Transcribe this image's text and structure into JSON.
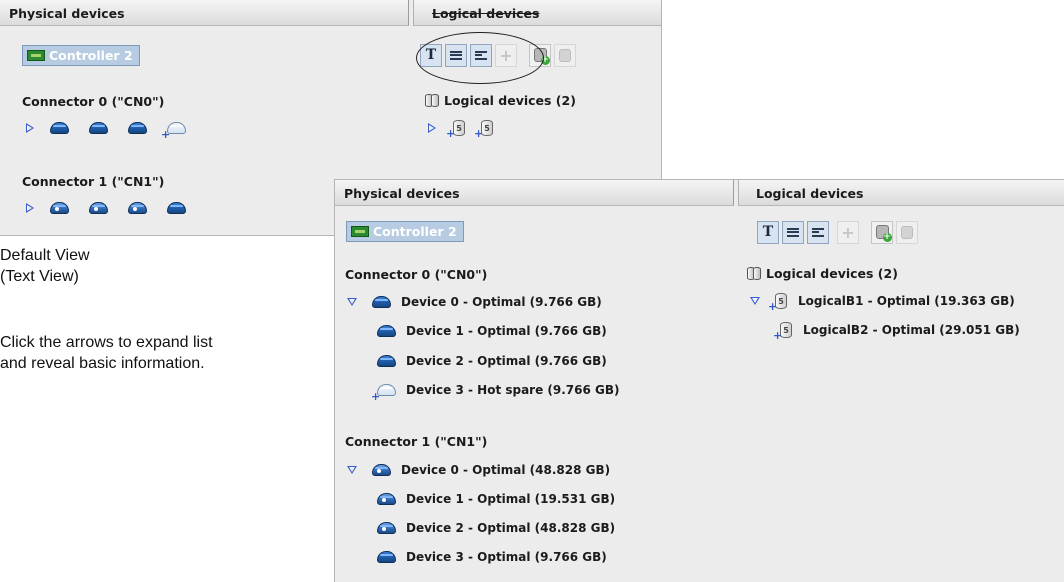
{
  "back_panel": {
    "physical_header": "Physical devices",
    "logical_header": "Logical devices",
    "controller_label": "Controller 2",
    "connector0_label": "Connector 0 (\"CN0\")",
    "connector1_label": "Connector 1 (\"CN1\")",
    "logical_group_label": "Logical devices (2)",
    "logical_device_badge": "5"
  },
  "front_panel": {
    "physical_header": "Physical devices",
    "logical_header": "Logical devices",
    "controller_label": "Controller 2",
    "connector0": {
      "label": "Connector 0 (\"CN0\")",
      "devices": [
        "Device 0 - Optimal (9.766 GB)",
        "Device 1 - Optimal (9.766 GB)",
        "Device 2 - Optimal (9.766 GB)",
        "Device 3 - Hot spare (9.766 GB)"
      ]
    },
    "connector1": {
      "label": "Connector 1 (\"CN1\")",
      "devices": [
        "Device 0 - Optimal (48.828 GB)",
        "Device 1 - Optimal (19.531 GB)",
        "Device 2 - Optimal (48.828 GB)",
        "Device 3 - Optimal (9.766 GB)"
      ]
    },
    "logical_group_label": "Logical devices (2)",
    "logical_devices": [
      "LogicalB1 - Optimal (19.363 GB)",
      "LogicalB2 - Optimal (29.051 GB)"
    ],
    "logical_device_badge": "5"
  },
  "toolbar": {
    "text_view_glyph": "T"
  },
  "annotation": {
    "line1": "Default View",
    "line2": "(Text View)",
    "line3": "Click the arrows to expand list",
    "line4": "and reveal basic information."
  },
  "icons": [
    "controller-icon",
    "expand-arrow-icon",
    "collapse-arrow-icon",
    "disk-icon",
    "hot-spare-disk-icon",
    "logical-device-icon",
    "logical-devices-group-icon",
    "add-logical-device-icon",
    "delete-logical-device-icon"
  ]
}
